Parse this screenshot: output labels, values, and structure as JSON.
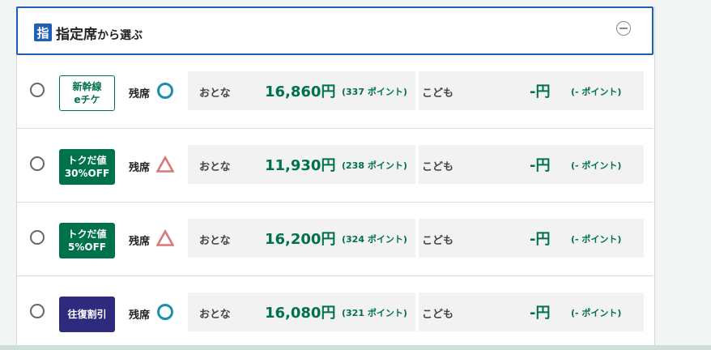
{
  "section": {
    "icon_char": "指",
    "title_main": "指定席",
    "title_sub": "から選ぶ"
  },
  "rows": [
    {
      "badge_line1": "新幹線",
      "badge_line2": "eチケ",
      "badge_style": "outline",
      "availability_label": "残席",
      "availability_symbol": "circle",
      "adult_label": "おとな",
      "adult_price": "16,860円",
      "adult_points": "(337 ポイント)",
      "child_label": "こども",
      "child_price": "-円",
      "child_points": "(- ポイント)"
    },
    {
      "badge_line1": "トクだ値",
      "badge_line2": "30%OFF",
      "badge_style": "green",
      "availability_label": "残席",
      "availability_symbol": "triangle",
      "adult_label": "おとな",
      "adult_price": "11,930円",
      "adult_points": "(238 ポイント)",
      "child_label": "こども",
      "child_price": "-円",
      "child_points": "(- ポイント)"
    },
    {
      "badge_line1": "トクだ値",
      "badge_line2": "5%OFF",
      "badge_style": "green",
      "availability_label": "残席",
      "availability_symbol": "triangle",
      "adult_label": "おとな",
      "adult_price": "16,200円",
      "adult_points": "(324 ポイント)",
      "child_label": "こども",
      "child_price": "-円",
      "child_points": "(- ポイント)"
    },
    {
      "badge_line1": "往復割引",
      "badge_line2": "",
      "badge_style": "navy",
      "availability_label": "残席",
      "availability_symbol": "circle",
      "adult_label": "おとな",
      "adult_price": "16,080円",
      "adult_points": "(321 ポイント)",
      "child_label": "こども",
      "child_price": "-円",
      "child_points": "(- ポイント)"
    }
  ],
  "colors": {
    "accent_blue": "#1f5fb6",
    "price_green": "#00724a",
    "navy_badge": "#2e2a7e",
    "circle_symbol": "#1a8fb0",
    "triangle_symbol": "#d9777a"
  }
}
